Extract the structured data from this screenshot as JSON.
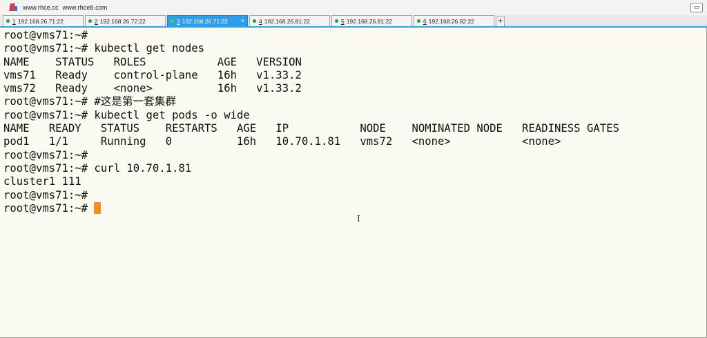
{
  "window": {
    "title_parts": [
      "www.rhce.cc",
      "www.rhce8.com"
    ],
    "restore_button": "▭"
  },
  "tabs": [
    {
      "num": "1",
      "label": "192.168.26.71:22",
      "active": false
    },
    {
      "num": "2",
      "label": "192.168.26.72:22",
      "active": false
    },
    {
      "num": "3",
      "label": "192.168.26.71:22",
      "active": true
    },
    {
      "num": "4",
      "label": "192.168.26.81:22",
      "active": false
    },
    {
      "num": "5",
      "label": "192.168.26.81:22",
      "active": false
    },
    {
      "num": "6",
      "label": "192.168.26.82:22",
      "active": false
    }
  ],
  "tab_add_label": "+",
  "tab_close_label": "×",
  "terminal": {
    "lines": [
      "root@vms71:~#",
      "root@vms71:~# kubectl get nodes",
      "NAME    STATUS   ROLES           AGE   VERSION",
      "vms71   Ready    control-plane   16h   v1.33.2",
      "vms72   Ready    <none>          16h   v1.33.2",
      "root@vms71:~# #这是第一套集群",
      "root@vms71:~# kubectl get pods -o wide",
      "NAME   READY   STATUS    RESTARTS   AGE   IP           NODE    NOMINATED NODE   READINESS GATES",
      "pod1   1/1     Running   0          16h   10.70.1.81   vms72   <none>           <none>",
      "root@vms71:~#",
      "root@vms71:~# curl 10.70.1.81",
      "cluster1 111",
      "root@vms71:~#"
    ],
    "prompt": "root@vms71:~# "
  },
  "colors": {
    "background": "#fafaf0",
    "active_tab": "#2f9de8",
    "cursor": "#ff8c1a",
    "tab_dot": "#1aa82a"
  }
}
